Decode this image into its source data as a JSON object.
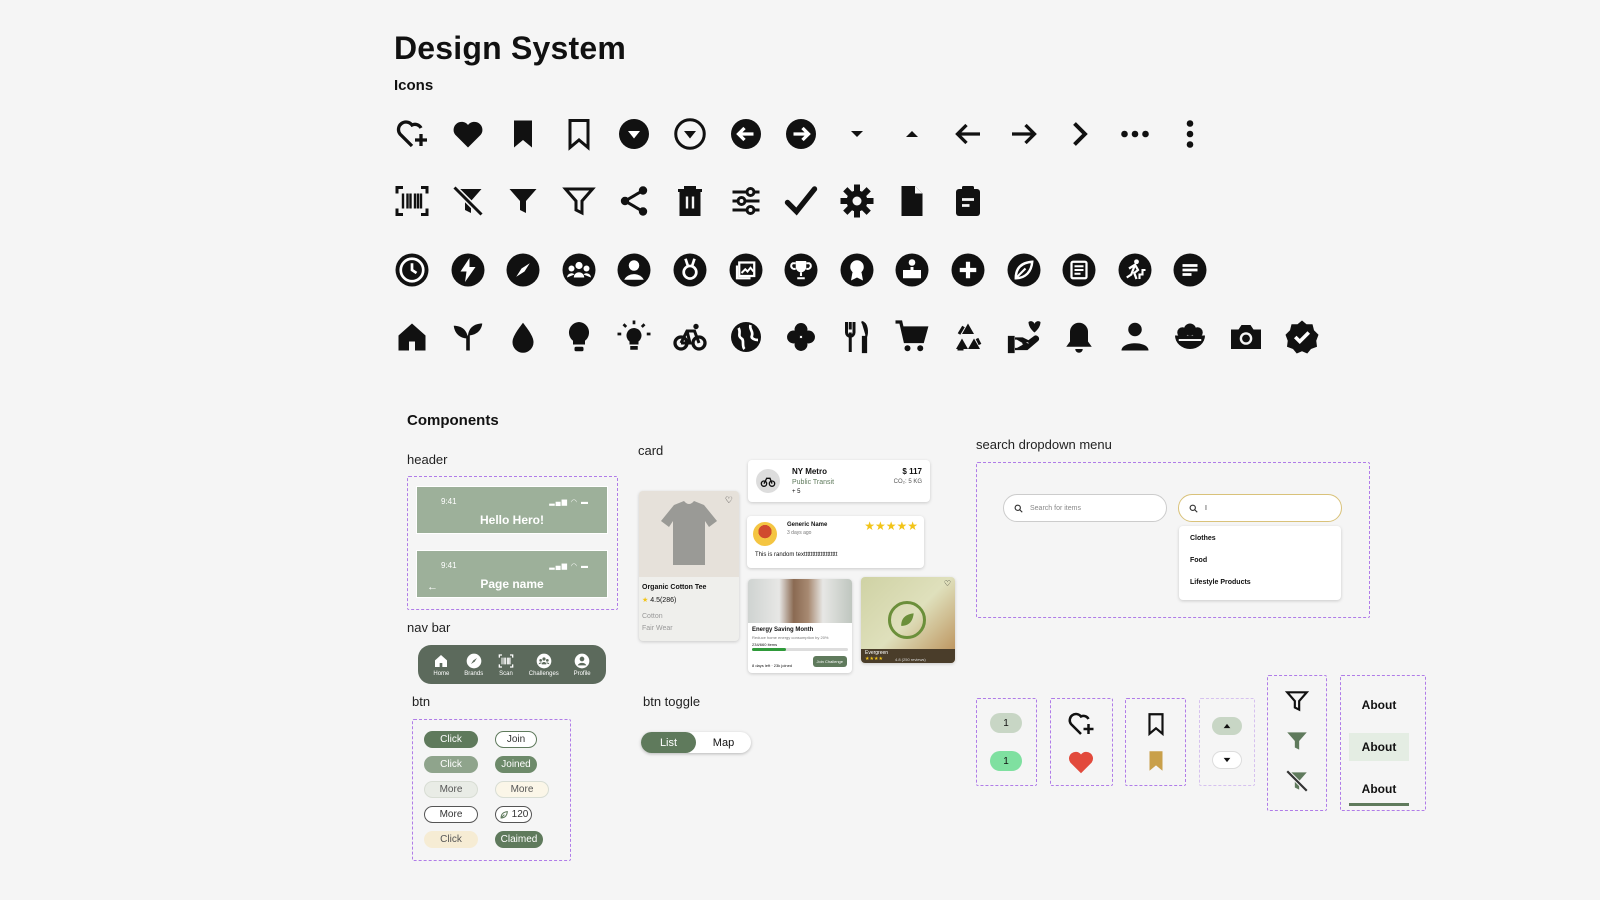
{
  "page": {
    "title": "Design System",
    "icons_heading": "Icons",
    "components_heading": "Components"
  },
  "icon_rows": [
    [
      "heart-plus-icon",
      "heart-filled-icon",
      "bookmark-filled-icon",
      "bookmark-outline-icon",
      "circle-chevron-down-filled-icon",
      "circle-chevron-down-outline-icon",
      "circle-arrow-left-icon",
      "circle-arrow-right-icon",
      "caret-down-icon",
      "caret-up-icon",
      "arrow-left-icon",
      "arrow-right-icon",
      "chevron-right-icon",
      "more-horizontal-icon",
      "more-vertical-icon"
    ],
    [
      "barcode-scan-icon",
      "filter-off-icon",
      "filter-filled-icon",
      "filter-outline-icon",
      "share-icon",
      "trash-icon",
      "sliders-icon",
      "check-icon",
      "gear-icon",
      "document-icon",
      "clipboard-icon"
    ],
    [
      "clock-icon",
      "lightning-icon",
      "compass-icon",
      "community-icon",
      "profile-icon",
      "medal-icon",
      "photo-gallery-icon",
      "trophy-icon",
      "award-icon",
      "podium-icon",
      "add-circle-icon",
      "leaf-circle-icon",
      "news-icon",
      "climb-icon",
      "chat-icon"
    ],
    [
      "home-icon",
      "sprout-icon",
      "water-drop-icon",
      "lightbulb-icon",
      "light-on-icon",
      "bicycle-icon",
      "globe-icon",
      "clover-icon",
      "restaurant-icon",
      "cart-icon",
      "recycle-icon",
      "hand-heart-icon",
      "bell-icon",
      "person-icon",
      "bowl-icon",
      "camera-icon",
      "verified-badge-icon"
    ]
  ],
  "sections": {
    "header": "header",
    "card": "card",
    "search": "search dropdown menu",
    "nav": "nav bar",
    "btn": "btn",
    "toggle": "btn toggle"
  },
  "header": {
    "time": "9:41",
    "home_title": "Hello Hero!",
    "page_title": "Page name",
    "status": "▂▄▆ ◠ ▬",
    "back": "←"
  },
  "nav": [
    {
      "label": "Home",
      "icon": "home-icon"
    },
    {
      "label": "Brands",
      "icon": "compass-icon"
    },
    {
      "label": "Scan",
      "icon": "barcode-scan-icon"
    },
    {
      "label": "Challenges",
      "icon": "community-icon"
    },
    {
      "label": "Profile",
      "icon": "profile-icon"
    }
  ],
  "buttons": {
    "click": "Click",
    "join": "Join",
    "joined": "Joined",
    "more": "More",
    "points": "120",
    "claimed": "Claimed"
  },
  "toggle": {
    "list": "List",
    "map": "Map"
  },
  "cards": {
    "product": {
      "name": "Organic Cotton Tee",
      "rating": "4.5(286)",
      "material": "Cotton",
      "tag": "Fair Wear"
    },
    "transit": {
      "title": "NY Metro",
      "type": "Public Transit",
      "points": "+ 5",
      "price": "$ 117",
      "co2": "CO₂: 5 KG"
    },
    "review": {
      "name": "Generic Name",
      "when": "3 days ago",
      "stars": "★★★★★",
      "text": "This is random textttttttttttttttttttt"
    },
    "challenge": {
      "title": "Energy Saving Month",
      "desc": "Reduce home energy consumption by 20%",
      "progress": 0.35,
      "count": "234/660 items",
      "meta": "8 days left · 23k joined",
      "cta": "Join Challenge"
    },
    "brand": {
      "name": "Evergreen",
      "stars": "★★★★",
      "rating": "4.8 (250 reviews)"
    }
  },
  "search": {
    "placeholder": "Search for items",
    "typed": "I",
    "options": [
      "Clothes",
      "Food",
      "Lifestyle Products"
    ]
  },
  "badge": {
    "count": "1"
  },
  "about": {
    "label": "About"
  },
  "colors": {
    "primary": "#5f7a5c",
    "header": "#9db09a",
    "dashed": "#b07ce8",
    "heart": "#e24a3c",
    "bookmark": "#c9a04a",
    "badge_green": "#7fe0a0",
    "star": "#f2c418"
  }
}
